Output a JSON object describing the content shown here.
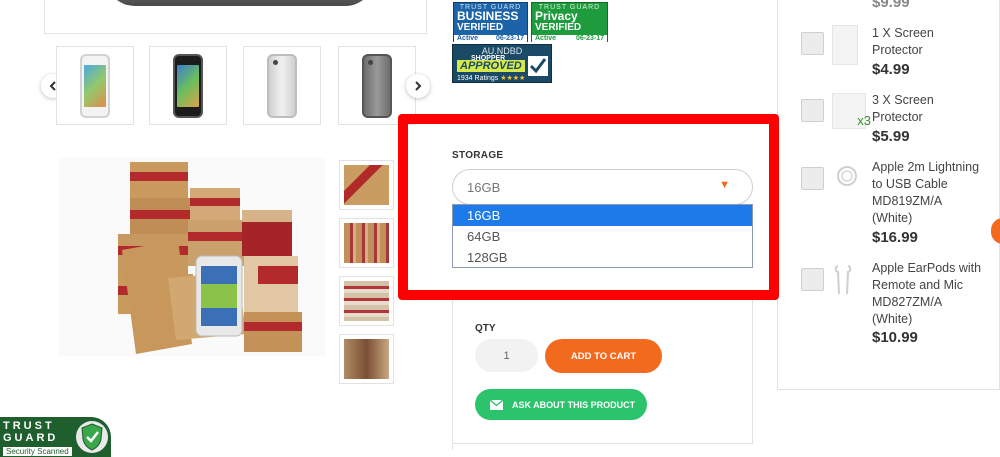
{
  "badges": {
    "business": {
      "top": "TRUST GUARD",
      "line1": "BUSINESS",
      "line2": "VERIFIED",
      "status": "Active",
      "date": "06-23-17"
    },
    "privacy": {
      "top": "TRUST GUARD",
      "line1": "Privacy",
      "line2": "VERIFIED",
      "status": "Active",
      "date": "06-23-17"
    },
    "shopper": {
      "code": "AU.NDBD",
      "line1": "SHOPPER",
      "line2": "APPROVED",
      "ratings": "1934 Ratings",
      "stars": "★★★★"
    }
  },
  "storage": {
    "label": "STORAGE",
    "selected": "16GB",
    "options": [
      "16GB",
      "64GB",
      "128GB"
    ]
  },
  "qty": {
    "label": "QTY",
    "value": "1"
  },
  "buttons": {
    "add_to_cart": "ADD TO CART",
    "ask": "ASK ABOUT THIS PRODUCT"
  },
  "recommended": {
    "top_price": "$9.99",
    "items": [
      {
        "name": "1 X Screen Protector",
        "price": "$4.99"
      },
      {
        "name": "3 X Screen Protector",
        "price": "$5.99",
        "tag": "x3"
      },
      {
        "name": "Apple 2m Lightning to USB Cable MD819ZM/A (White)",
        "price": "$16.99"
      },
      {
        "name": "Apple EarPods with Remote and Mic MD827ZM/A (White)",
        "price": "$10.99"
      }
    ]
  },
  "trust_seal": {
    "line1": "TRUST",
    "line2": "GUARD",
    "scanned": "Security Scanned"
  },
  "colors": {
    "accent_orange": "#f26a1e",
    "ask_green": "#2bc46d",
    "select_blue": "#1e7ae8",
    "highlight_red": "#ff0000"
  }
}
